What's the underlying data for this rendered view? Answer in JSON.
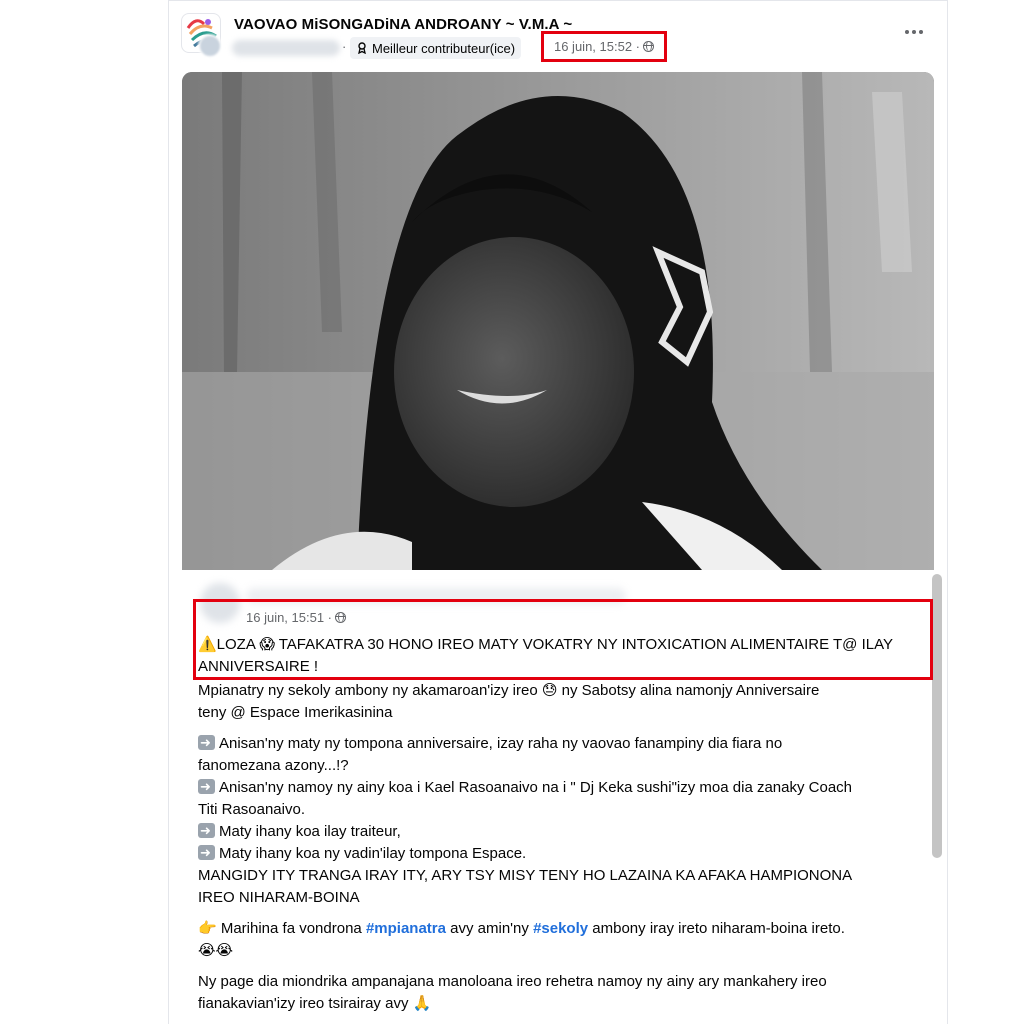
{
  "post": {
    "group_name": "VAOVAO MiSONGADiNA ANDROANY ~ V.M.A ~",
    "dot": "·",
    "badge_label": "Meilleur contributeur(ice)",
    "timestamp": "16 juin, 15:52 ·",
    "more_icon": "more-horizontal-icon"
  },
  "shared_post": {
    "timestamp": "16 juin, 15:51 ·",
    "headline_line1": "⚠️LOZA 😱 TAFAKATRA 30 HONO IREO MATY VOKATRY NY INTOXICATION ALIMENTAIRE T@ ILAY",
    "headline_line2": "ANNIVERSAIRE !",
    "p1_line1": "Mpianatry ny sekoly ambony ny akamaroan'izy ireo 😓 ny Sabotsy alina namonjy Anniversaire",
    "p1_line2": "teny @ Espace Imerikasinina",
    "b1_line1": "Anisan'ny maty  ny tompona anniversaire, izay raha ny vaovao fanampiny dia fiara no",
    "b1_line2": "fanomezana azony...!?",
    "b2_line1": "Anisan'ny namoy ny ainy koa i Kael Rasoanaivo na i \" Dj Keka sushi\"izy moa dia zanaky Coach",
    "b2_line2": "Titi Rasoanaivo.",
    "b3": "Maty ihany koa ilay traiteur,",
    "b4": "Maty ihany koa ny  vadin'ilay tompona Espace.",
    "caps_line1": "MANGIDY ITY TRANGA IRAY ITY, ARY TSY MISY TENY HO LAZAINA KA AFAKA HAMPIONONA",
    "caps_line2": "IREO NIHARAM-BOINA",
    "p3_pre": "👉 Marihina fa vondrona",
    "p3_tag1": "#mpianatra",
    "p3_mid": "avy amin'ny",
    "p3_tag2": "#sekoly",
    "p3_post": "ambony iray ireto niharam-boina ireto.",
    "p3_line2": "😭😭",
    "p4_line1": "Ny page dia miondrika ampanajana manoloana ireo rehetra namoy ny ainy ary mankahery ireo",
    "p4_line2": "fianakavian'izy ireo tsirairay avy 🙏"
  },
  "colors": {
    "highlight_border": "#e3000f",
    "hashtag": "#216fdb",
    "meta_text": "#65676b"
  }
}
